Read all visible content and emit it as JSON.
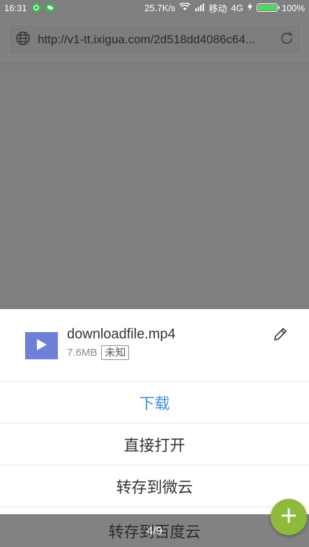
{
  "status_bar": {
    "time": "16:31",
    "speed": "25.7K/s",
    "carrier": "移动",
    "network": "4G",
    "battery": "100%",
    "battery_level": 1.0
  },
  "url_bar": {
    "url": "http://v1-tt.ixigua.com/2d518dd4086c64..."
  },
  "file": {
    "name": "downloadfile.mp4",
    "size": "7.6MB",
    "tag": "未知"
  },
  "actions": {
    "download": "下载",
    "open_directly": "直接打开",
    "save_weiyun": "转存到微云",
    "save_baidu": "转存到百度云"
  },
  "pager": {
    "indicator": "4/9"
  },
  "colors": {
    "accent": "#3c8fdd",
    "fab": "#8dba3a",
    "thumb": "#6f80d8"
  }
}
